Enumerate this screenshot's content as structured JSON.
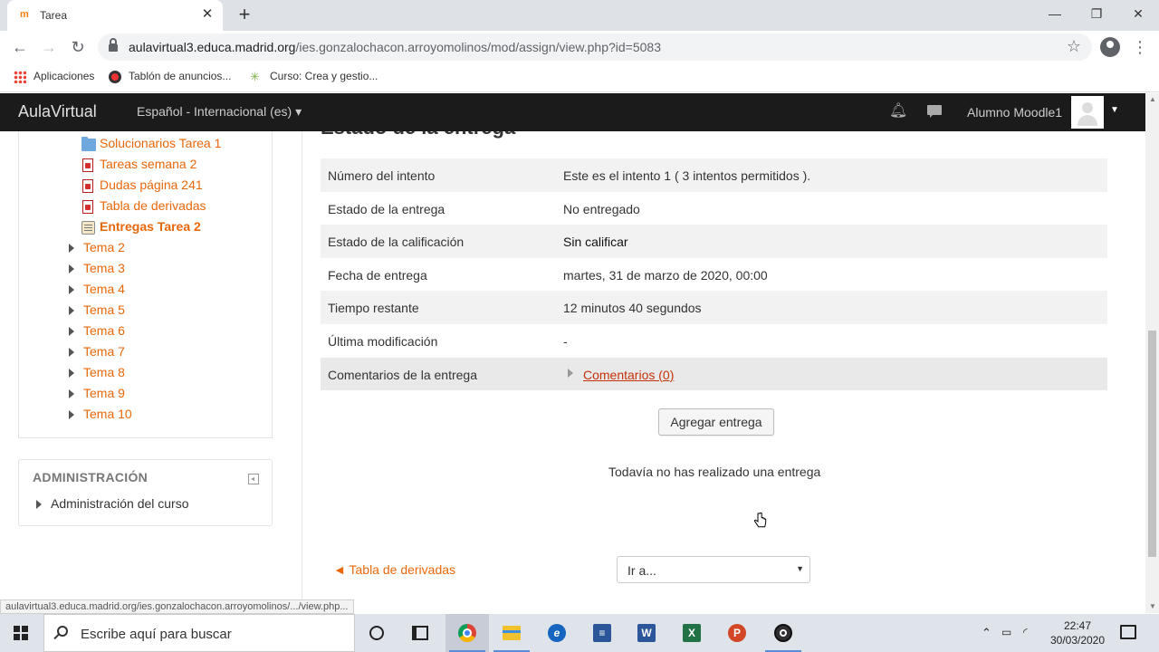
{
  "browser": {
    "tab_title": "Tarea",
    "tab_favicon_text": "m",
    "url_host": "aulavirtual3.educa.madrid.org",
    "url_path": "/ies.gonzalochacon.arroyomolinos/mod/assign/view.php?id=5083",
    "bookmarks": [
      "Aplicaciones",
      "Tablón de anuncios...",
      "Curso: Crea y gestio..."
    ],
    "status_url": "aulavirtual3.educa.madrid.org/ies.gonzalochacon.arroyomolinos/.../view.php..."
  },
  "navbar": {
    "brand": "AulaVirtual",
    "language": "Español - Internacional (es) ▾",
    "user": "Alumno Moodle1"
  },
  "sidebar": {
    "resources": [
      {
        "label": "Solucionarios Tarea 1",
        "icon": "folder-icon"
      },
      {
        "label": "Tareas semana 2",
        "icon": "pdf-icon"
      },
      {
        "label": "Dudas página 241",
        "icon": "pdf-icon"
      },
      {
        "label": "Tabla de derivadas",
        "icon": "pdf-icon"
      },
      {
        "label": "Entregas Tarea 2",
        "icon": "assignment-icon",
        "current": true
      }
    ],
    "topics": [
      "Tema 2",
      "Tema 3",
      "Tema 4",
      "Tema 5",
      "Tema 6",
      "Tema 7",
      "Tema 8",
      "Tema 9",
      "Tema 10"
    ],
    "admin_title": "ADMINISTRACIÓN",
    "admin_item": "Administración del curso"
  },
  "main": {
    "heading": "Estado de la entrega",
    "rows": [
      {
        "label": "Número del intento",
        "value": "Este es el intento 1 ( 3 intentos permitidos )."
      },
      {
        "label": "Estado de la entrega",
        "value": "No entregado"
      },
      {
        "label": "Estado de la calificación",
        "value": "Sin calificar"
      },
      {
        "label": "Fecha de entrega",
        "value": "martes, 31 de marzo de 2020, 00:00"
      },
      {
        "label": "Tiempo restante",
        "value": "12 minutos 40 segundos"
      },
      {
        "label": "Última modificación",
        "value": "-"
      },
      {
        "label": "Comentarios de la entrega",
        "value": "Comentarios (0)"
      }
    ],
    "submit_button": "Agregar entrega",
    "no_submission": "Todavía no has realizado una entrega",
    "prev_activity": "◄ Tabla de derivadas",
    "jump_to": "Ir a..."
  },
  "taskbar": {
    "search_placeholder": "Escribe aquí para buscar",
    "time": "22:47",
    "date": "30/03/2020"
  },
  "colors": {
    "accent": "#e8670b",
    "navbar": "#1b1b1b",
    "link_visited": "#c4320a"
  }
}
